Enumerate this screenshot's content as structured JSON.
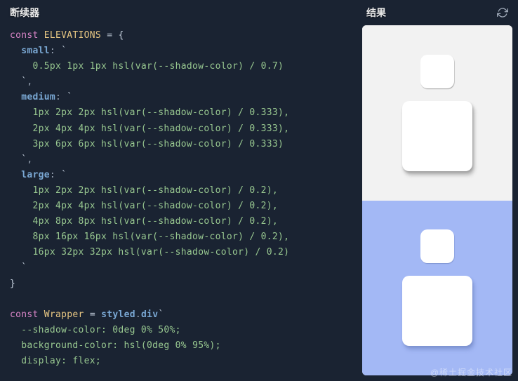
{
  "left": {
    "title": "断续器",
    "tokens": [
      [
        [
          "kw",
          "const"
        ],
        [
          "",
          ""
        ],
        [
          "const-name",
          "ELEVATIONS"
        ],
        [
          "",
          " "
        ],
        [
          "brace",
          "="
        ],
        [
          "",
          " "
        ],
        [
          "brace",
          "{"
        ]
      ],
      [
        [
          "",
          "  "
        ],
        [
          "prop",
          "small"
        ],
        [
          "punct",
          ":"
        ],
        [
          "",
          " `"
        ]
      ],
      [
        [
          "",
          "    "
        ],
        [
          "str",
          "0.5px 1px 1px hsl(var(--shadow-color) / 0.7)"
        ]
      ],
      [
        [
          "",
          "  `"
        ],
        [
          "punct",
          ","
        ]
      ],
      [
        [
          "",
          "  "
        ],
        [
          "prop",
          "medium"
        ],
        [
          "punct",
          ":"
        ],
        [
          "",
          " `"
        ]
      ],
      [
        [
          "",
          "    "
        ],
        [
          "str",
          "1px 2px 2px hsl(var(--shadow-color) / 0.333),"
        ]
      ],
      [
        [
          "",
          "    "
        ],
        [
          "str",
          "2px 4px 4px hsl(var(--shadow-color) / 0.333),"
        ]
      ],
      [
        [
          "",
          "    "
        ],
        [
          "str",
          "3px 6px 6px hsl(var(--shadow-color) / 0.333)"
        ]
      ],
      [
        [
          "",
          "  `"
        ],
        [
          "punct",
          ","
        ]
      ],
      [
        [
          "",
          "  "
        ],
        [
          "prop",
          "large"
        ],
        [
          "punct",
          ":"
        ],
        [
          "",
          " `"
        ]
      ],
      [
        [
          "",
          "    "
        ],
        [
          "str",
          "1px 2px 2px hsl(var(--shadow-color) / 0.2),"
        ]
      ],
      [
        [
          "",
          "    "
        ],
        [
          "str",
          "2px 4px 4px hsl(var(--shadow-color) / 0.2),"
        ]
      ],
      [
        [
          "",
          "    "
        ],
        [
          "str",
          "4px 8px 8px hsl(var(--shadow-color) / 0.2),"
        ]
      ],
      [
        [
          "",
          "    "
        ],
        [
          "str",
          "8px 16px 16px hsl(var(--shadow-color) / 0.2),"
        ]
      ],
      [
        [
          "",
          "    "
        ],
        [
          "str",
          "16px 32px 32px hsl(var(--shadow-color) / 0.2)"
        ]
      ],
      [
        [
          "",
          "  `"
        ]
      ],
      [
        [
          "brace",
          "}"
        ]
      ],
      [
        [
          "",
          ""
        ]
      ],
      [
        [
          "kw",
          "const"
        ],
        [
          "",
          " "
        ],
        [
          "const-name",
          "Wrapper"
        ],
        [
          "",
          " "
        ],
        [
          "brace",
          "="
        ],
        [
          "",
          " "
        ],
        [
          "prop",
          "styled"
        ],
        [
          "punct",
          "."
        ],
        [
          "prop",
          "div"
        ],
        [
          "",
          "`"
        ]
      ],
      [
        [
          "",
          "  "
        ],
        [
          "str",
          "--shadow-color: 0deg 0% 50%;"
        ]
      ],
      [
        [
          "",
          "  "
        ],
        [
          "str",
          "background-color: hsl(0deg 0% 95%);"
        ]
      ],
      [
        [
          "",
          "  "
        ],
        [
          "str",
          "display: flex;"
        ]
      ]
    ]
  },
  "right": {
    "title": "结果"
  },
  "watermark": "@稀土掘金技术社区"
}
